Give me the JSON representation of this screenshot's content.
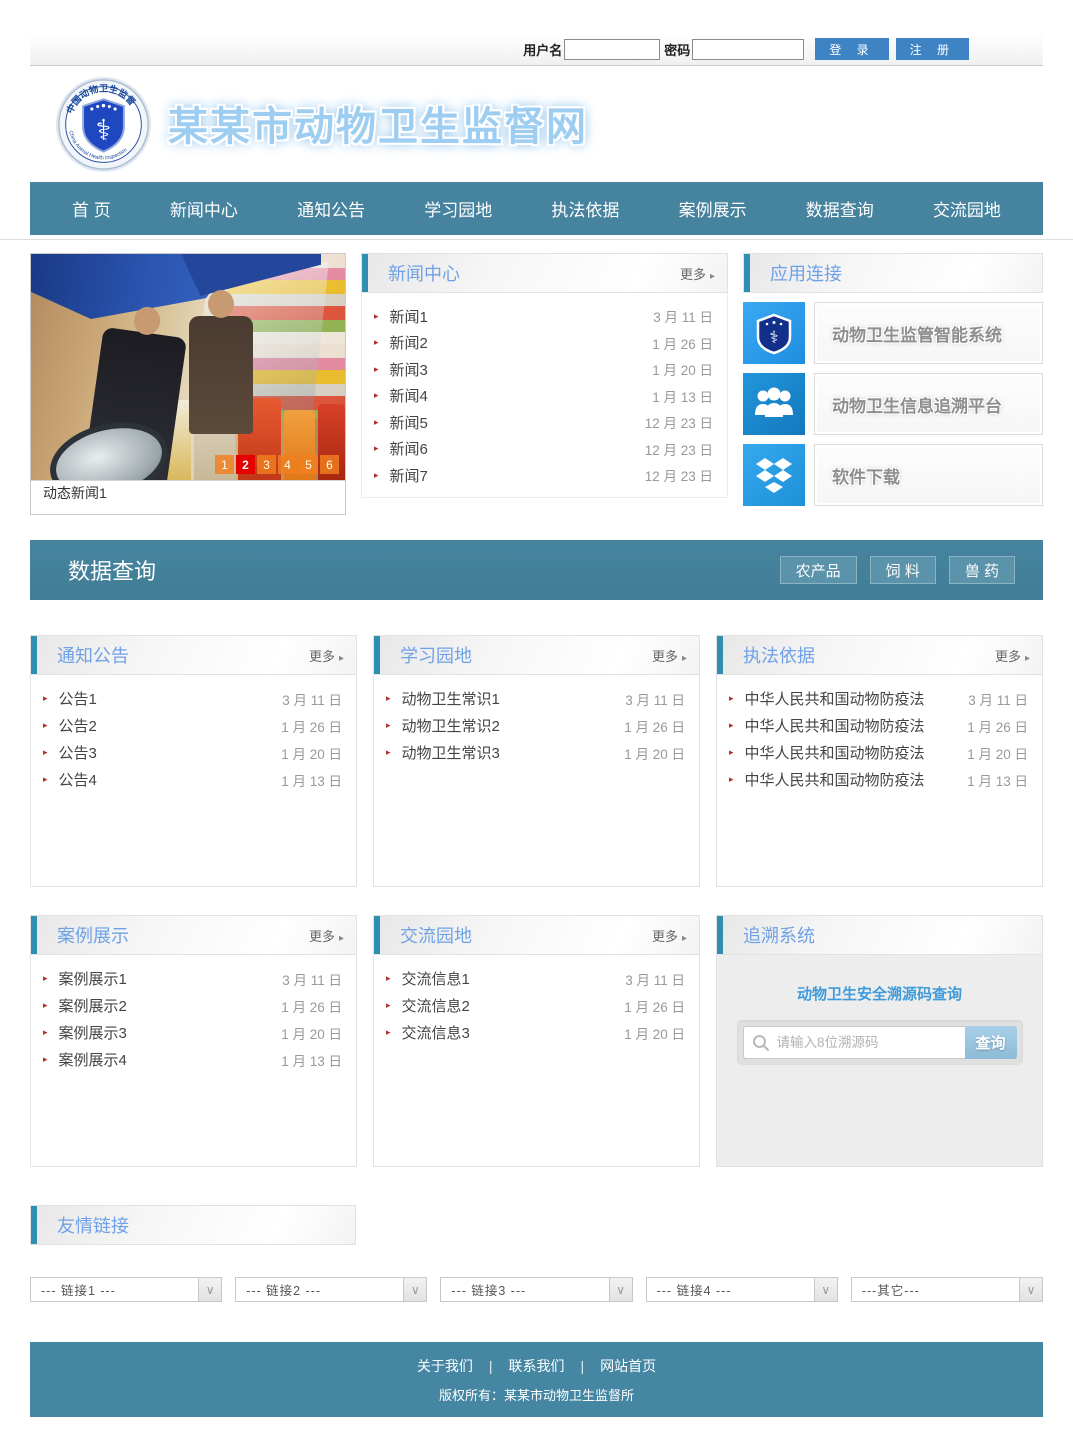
{
  "login": {
    "username_label": "用户名",
    "password_label": "密码",
    "login_button": "登 录",
    "register_button": "注 册"
  },
  "header": {
    "site_title": "某某市动物卫生监督网",
    "logo_arc_top": "中国动物卫生监督",
    "logo_arc_bottom": "China Animal Health Inspection"
  },
  "nav": {
    "items": [
      "首  页",
      "新闻中心",
      "通知公告",
      "学习园地",
      "执法依据",
      "案例展示",
      "数据查询",
      "交流园地"
    ]
  },
  "carousel": {
    "caption": "动态新闻1",
    "pages": [
      "1",
      "2",
      "3",
      "4",
      "5",
      "6"
    ],
    "active_page": "2"
  },
  "news": {
    "title": "新闻中心",
    "more_label": "更多",
    "more_arrow": "▸",
    "items": [
      {
        "title": "新闻1",
        "date": "3 月 11 日"
      },
      {
        "title": "新闻2",
        "date": "1 月 26 日"
      },
      {
        "title": "新闻3",
        "date": "1 月 20 日"
      },
      {
        "title": "新闻4",
        "date": "1 月 13 日"
      },
      {
        "title": "新闻5",
        "date": "12 月 23 日"
      },
      {
        "title": "新闻6",
        "date": "12 月 23 日"
      },
      {
        "title": "新闻7",
        "date": "12 月 23 日"
      }
    ]
  },
  "apps": {
    "title": "应用连接",
    "items": [
      {
        "label": "动物卫生监管智能系统",
        "icon": "shield-badge-icon"
      },
      {
        "label": "动物卫生信息追溯平台",
        "icon": "people-icon"
      },
      {
        "label": "软件下载",
        "icon": "download-box-icon"
      }
    ]
  },
  "data_band": {
    "title": "数据查询",
    "buttons": [
      "农产品",
      "饲 料",
      "兽 药"
    ]
  },
  "notice": {
    "title": "通知公告",
    "more_label": "更多",
    "more_arrow": "▸",
    "items": [
      {
        "title": "公告1",
        "date": "3 月 11 日"
      },
      {
        "title": "公告2",
        "date": "1 月 26 日"
      },
      {
        "title": "公告3",
        "date": "1 月 20 日"
      },
      {
        "title": "公告4",
        "date": "1 月 13 日"
      }
    ]
  },
  "study": {
    "title": "学习园地",
    "more_label": "更多",
    "more_arrow": "▸",
    "items": [
      {
        "title": "动物卫生常识1",
        "date": "3 月 11 日"
      },
      {
        "title": "动物卫生常识2",
        "date": "1 月 26 日"
      },
      {
        "title": "动物卫生常识3",
        "date": "1 月 20 日"
      }
    ]
  },
  "law": {
    "title": "执法依据",
    "more_label": "更多",
    "more_arrow": "▸",
    "items": [
      {
        "title": "中华人民共和国动物防疫法",
        "date": "3 月 11 日"
      },
      {
        "title": "中华人民共和国动物防疫法",
        "date": "1 月 26 日"
      },
      {
        "title": "中华人民共和国动物防疫法",
        "date": "1 月 20 日"
      },
      {
        "title": "中华人民共和国动物防疫法",
        "date": "1 月 13 日"
      }
    ]
  },
  "cases": {
    "title": "案例展示",
    "more_label": "更多",
    "more_arrow": "▸",
    "items": [
      {
        "title": "案例展示1",
        "date": "3 月 11 日"
      },
      {
        "title": "案例展示2",
        "date": "1 月 26 日"
      },
      {
        "title": "案例展示3",
        "date": "1 月 20 日"
      },
      {
        "title": "案例展示4",
        "date": "1 月 13 日"
      }
    ]
  },
  "exchange": {
    "title": "交流园地",
    "more_label": "更多",
    "more_arrow": "▸",
    "items": [
      {
        "title": "交流信息1",
        "date": "3 月 11 日"
      },
      {
        "title": "交流信息2",
        "date": "1 月 26 日"
      },
      {
        "title": "交流信息3",
        "date": "1 月 20 日"
      }
    ]
  },
  "trace": {
    "title": "追溯系统",
    "heading": "动物卫生安全溯源码查询",
    "placeholder": "请输入8位溯源码",
    "search_button": "查询"
  },
  "friends": {
    "title": "友情链接",
    "selects": [
      "--- 链接1 ---",
      "--- 链接2 ---",
      "--- 链接3 ---",
      "--- 链接4 ---",
      "---其它---"
    ]
  },
  "footer": {
    "links": [
      "关于我们",
      "联系我们",
      "网站首页"
    ],
    "separator": "|",
    "copyright": "版权所有：某某市动物卫生监督所"
  },
  "colors": {
    "teal": "#46839f",
    "band_teal": "#417d96",
    "button_blue": "#3e83c4",
    "title_blue": "#6fa1e6",
    "active_red": "#e60000",
    "pager_orange": "#f07f1e"
  }
}
